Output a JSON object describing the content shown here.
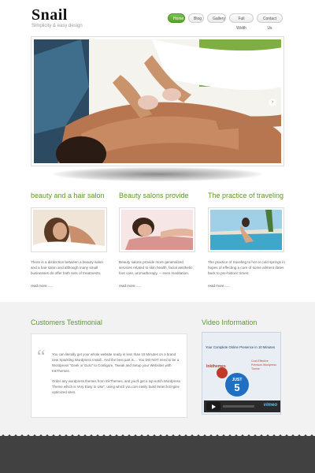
{
  "header": {
    "logo": "Snail",
    "tagline": "Simplicity & easy design"
  },
  "nav": {
    "items": [
      "Home",
      "Blog",
      "Gallery",
      "Full Width",
      "Contact Us"
    ],
    "active_index": 0
  },
  "features": [
    {
      "title": "beauty and a hair salon",
      "text": "There is a distinction between a beauty salon and a hair salon and although many small businesses do offer both sets of treatments.",
      "more": "read more......"
    },
    {
      "title": "Beauty salons provide",
      "text": "Beauty salons provide more generalized services related to skin health, facial aesthetic, foot care, aromatherapy, -- even meditation.",
      "more": "read more......"
    },
    {
      "title": "The practice of traveling",
      "text": "The practice of traveling to hot or cold springs in hopes of effecting a cure of some ailment dates back to pre-historic times.",
      "more": "read more......"
    }
  ],
  "testimonial": {
    "title": "Customers Testimonial",
    "paragraphs": [
      "You can literally get your whole website ready in less than 10 Minutes on a brand new Sparkling Wordpress Install.. And the best part is.... You DO NOT need to be a Wordpress \"Geek or Guru\" to Configure, Tweak and Setup your Websites with InkThemes.",
      "Order any wordpress themes from InkThemes, and you'll get a top notch Wordpress Theme which is Very Easy to Use\", using which you can easily build Search Engine optimized sites."
    ]
  },
  "video": {
    "title": "Video Information",
    "headline": "Your Complete Online Presence in 10 Minutes",
    "brand": "Inkthemes",
    "side_text": "Cost-Effective Premium Wordpress Theme",
    "badge_top": "JUST",
    "badge_num": "5",
    "player": "vimeo"
  },
  "colors": {
    "accent_green": "#5d9a2c",
    "footer": "#414141",
    "bottom_bg": "#f2f2f2"
  }
}
